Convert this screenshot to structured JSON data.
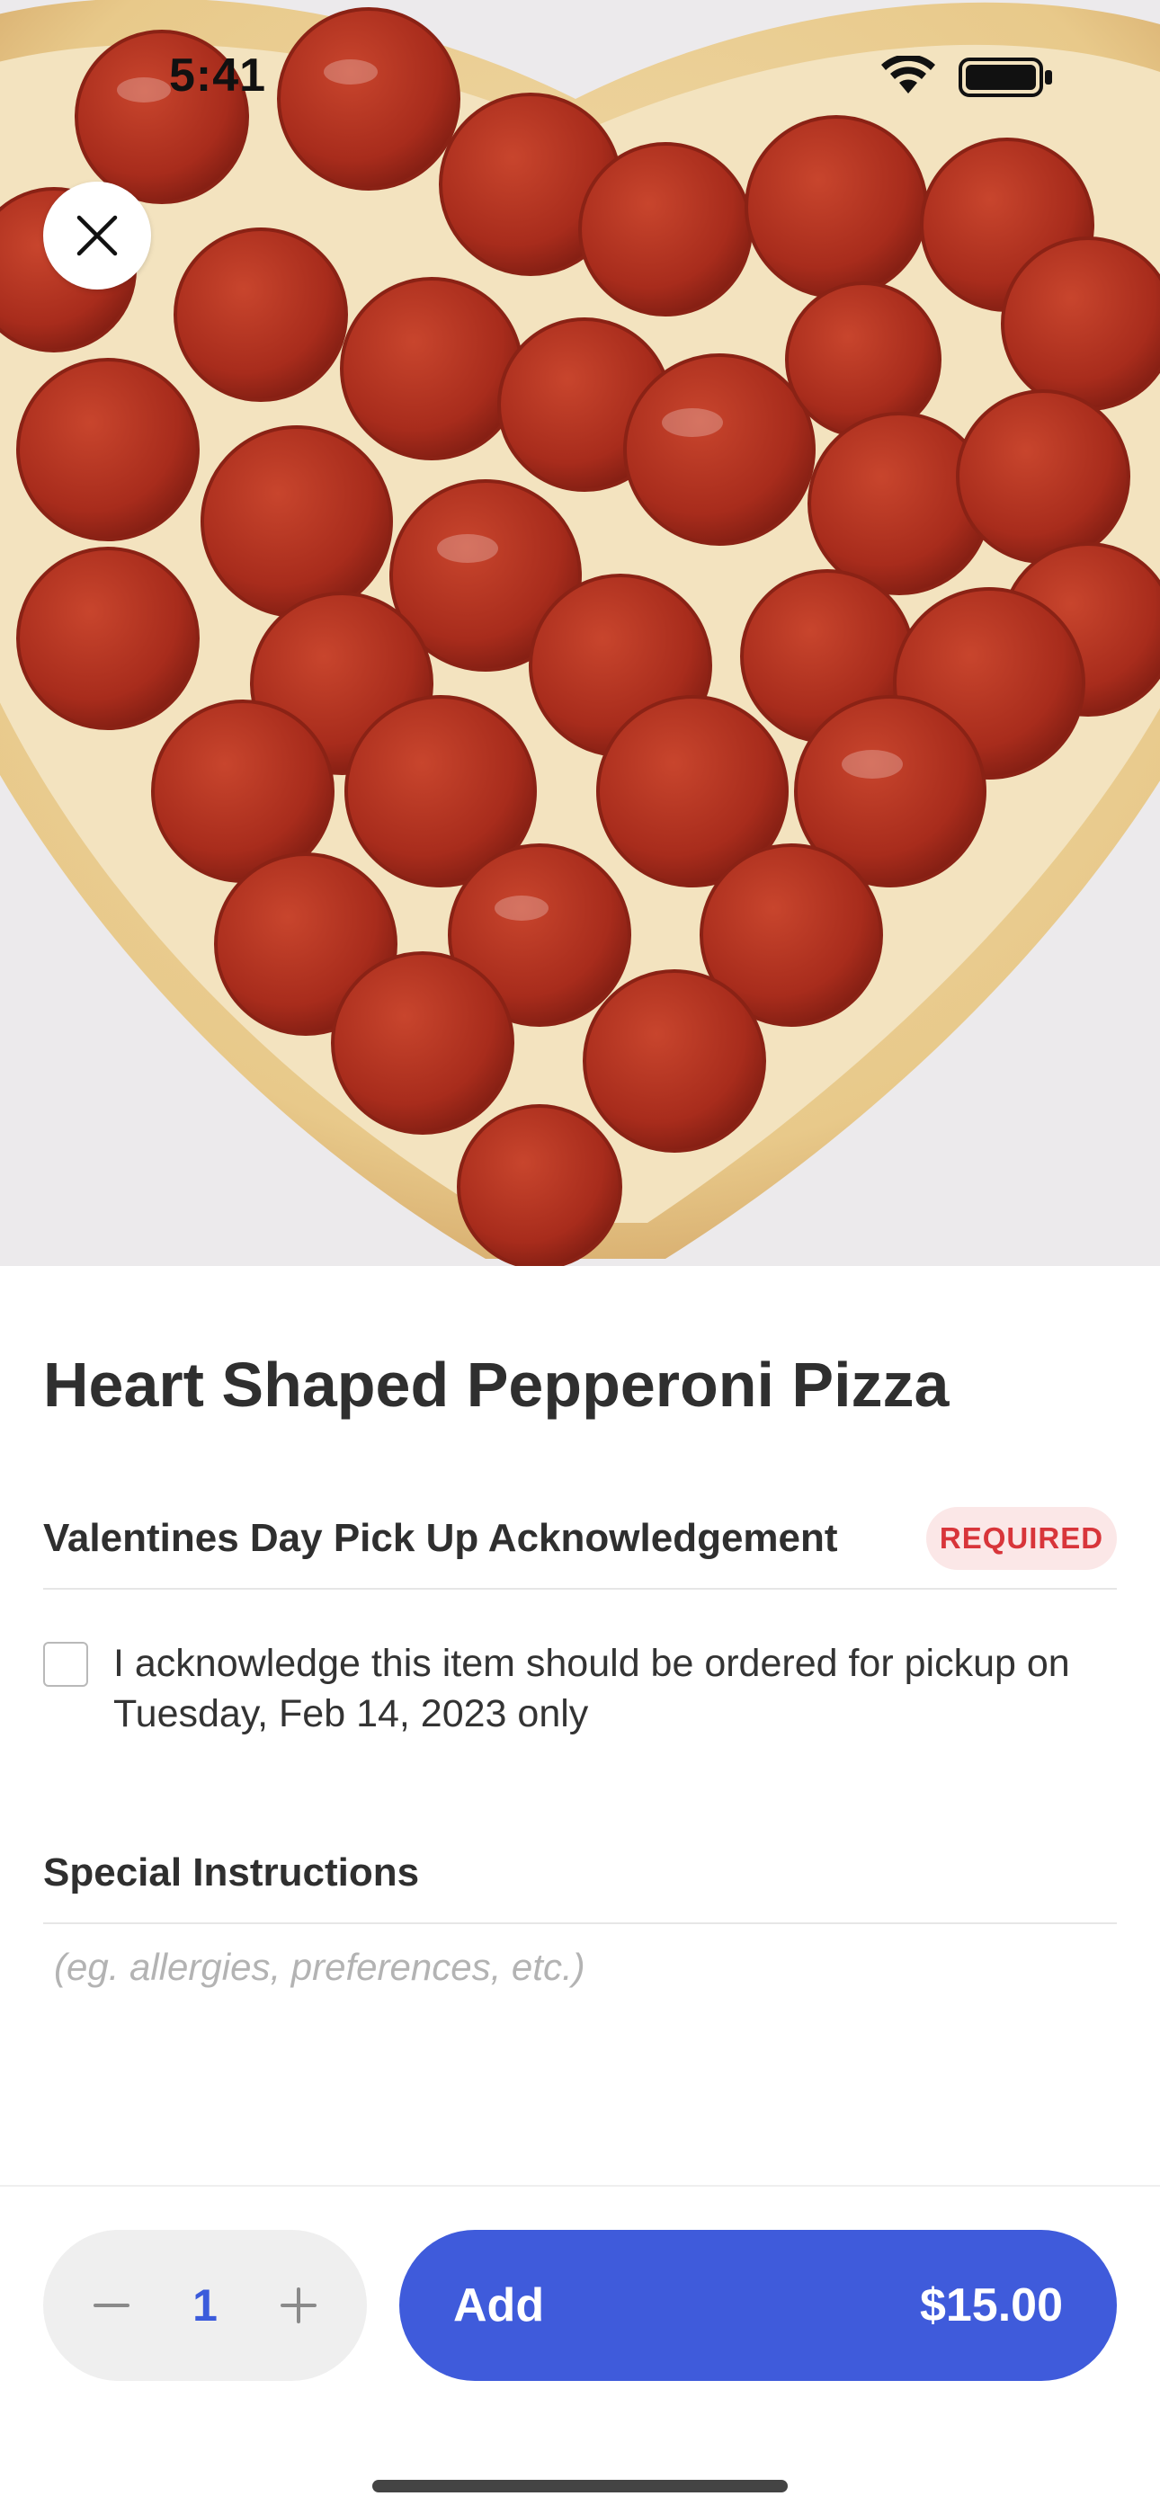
{
  "status_bar": {
    "time": "5:41"
  },
  "hero": {
    "image_alt": "heart shaped pepperoni pizza photo"
  },
  "item": {
    "title": "Heart Shaped Pepperoni Pizza"
  },
  "acknowledgement": {
    "label": "Valentines Day Pick Up Acknowledgement",
    "badge": "REQUIRED",
    "checkbox_text": "I acknowledge this item should be ordered for pickup on Tuesday, Feb 14, 2023 only",
    "checked": false
  },
  "special_instructions": {
    "label": "Special Instructions",
    "placeholder": "(eg. allergies, preferences, etc.)"
  },
  "footer": {
    "quantity": "1",
    "add_label": "Add",
    "price": "$15.00"
  },
  "colors": {
    "accent": "#3f5bdb",
    "required_text": "#d8353a",
    "required_bg": "#fbe7e7"
  },
  "icons": [
    "close-icon",
    "wifi-icon",
    "battery-icon",
    "minus-icon",
    "plus-icon"
  ]
}
